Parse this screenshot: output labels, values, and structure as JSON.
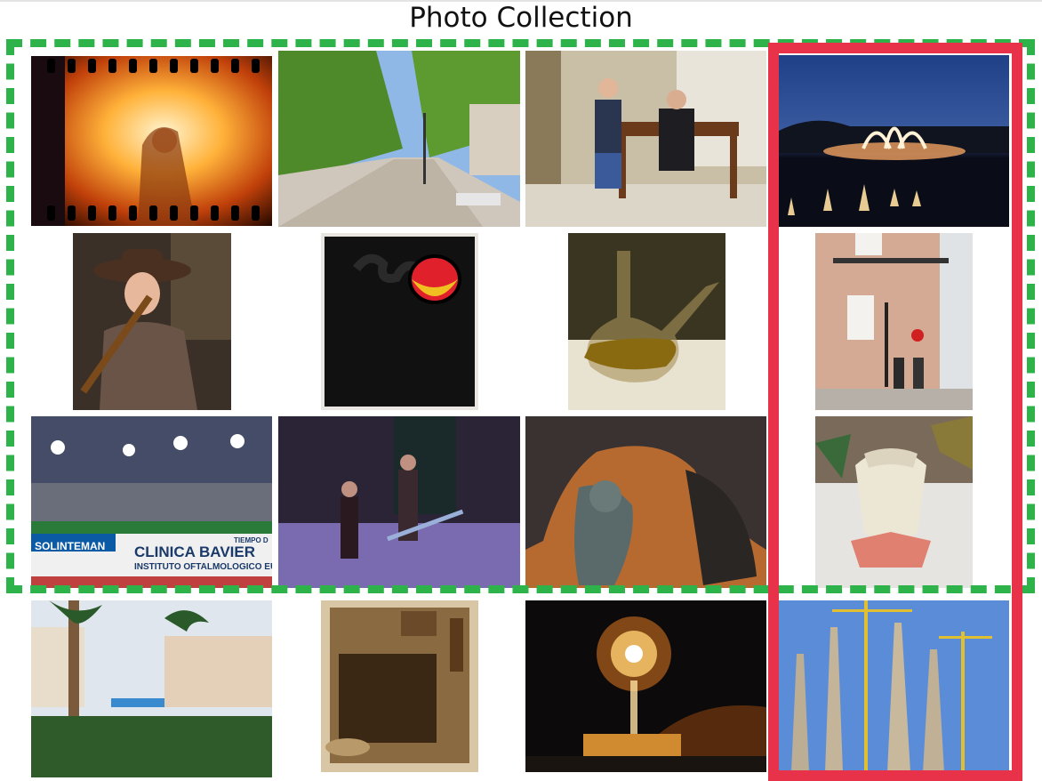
{
  "title": "Photo Collection",
  "colors": {
    "background": "#ffffff",
    "green_dashed_frame": "#2db34a",
    "red_highlight_frame": "#e8324a"
  },
  "photos": [
    {
      "row": 1,
      "col": 1,
      "description": "backlit film-strip photo of a person in a sunlit room"
    },
    {
      "row": 1,
      "col": 2,
      "description": "tree-lined pedestrian boulevard"
    },
    {
      "row": 1,
      "col": 3,
      "description": "woman gesturing beside a man seated on a wooden bench"
    },
    {
      "row": 1,
      "col": 4,
      "description": "illuminated fountain at night"
    },
    {
      "row": 2,
      "col": 1,
      "description": "young man in a cowboy hat holding a rifle"
    },
    {
      "row": 2,
      "col": 2,
      "description": "abstract painting with black shapes and a red circle"
    },
    {
      "row": 2,
      "col": 3,
      "description": "glass oil cruet on a table"
    },
    {
      "row": 2,
      "col": 4,
      "description": "pink building with balcony and street lamp"
    },
    {
      "row": 3,
      "col": 1,
      "description": "floodlit football stadium",
      "signs": [
        "SOLINTEMAN",
        "CLINICA BAVIER",
        "INSTITUTO OFTALMOLOGICO EURO",
        "TIEMPO D"
      ]
    },
    {
      "row": 3,
      "col": 2,
      "description": "band performing on a purple-lit stage"
    },
    {
      "row": 3,
      "col": 3,
      "description": "close-up of a bronze sculpture"
    },
    {
      "row": 3,
      "col": 4,
      "description": "origami face with paper folds"
    },
    {
      "row": 4,
      "col": 1,
      "description": "palm trees in front of hotel buildings"
    },
    {
      "row": 4,
      "col": 2,
      "description": "sepia photo of a piano and objects"
    },
    {
      "row": 4,
      "col": 3,
      "description": "fireworks over a coastal castle at night"
    },
    {
      "row": 4,
      "col": 4,
      "description": "cathedral spires with construction cranes"
    }
  ]
}
